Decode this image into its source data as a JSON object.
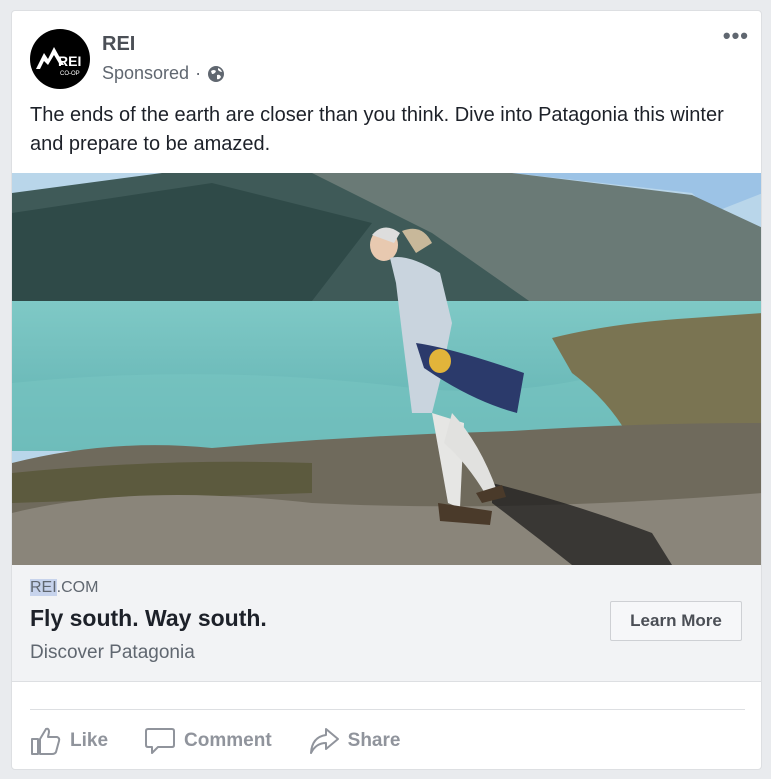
{
  "post": {
    "page_name": "REI",
    "sponsored_label": "Sponsored",
    "dot": "·",
    "more_label": "•••",
    "text": "The ends of the earth are closer than you think. Dive into Patagonia this winter and prepare to be amazed."
  },
  "logo": {
    "main": "REI",
    "sub": "CO-OP"
  },
  "link": {
    "domain_highlight": "REI",
    "domain_rest": ".COM",
    "headline": "Fly south. Way south.",
    "description": "Discover Patagonia",
    "cta_label": "Learn More"
  },
  "actions": [
    {
      "label": "Like",
      "icon": "thumbs-up-icon"
    },
    {
      "label": "Comment",
      "icon": "comment-icon"
    },
    {
      "label": "Share",
      "icon": "share-icon"
    }
  ],
  "colors": {
    "accent_link": "#4b4f56",
    "background": "#e9ebee",
    "link_box": "#f2f3f5"
  }
}
